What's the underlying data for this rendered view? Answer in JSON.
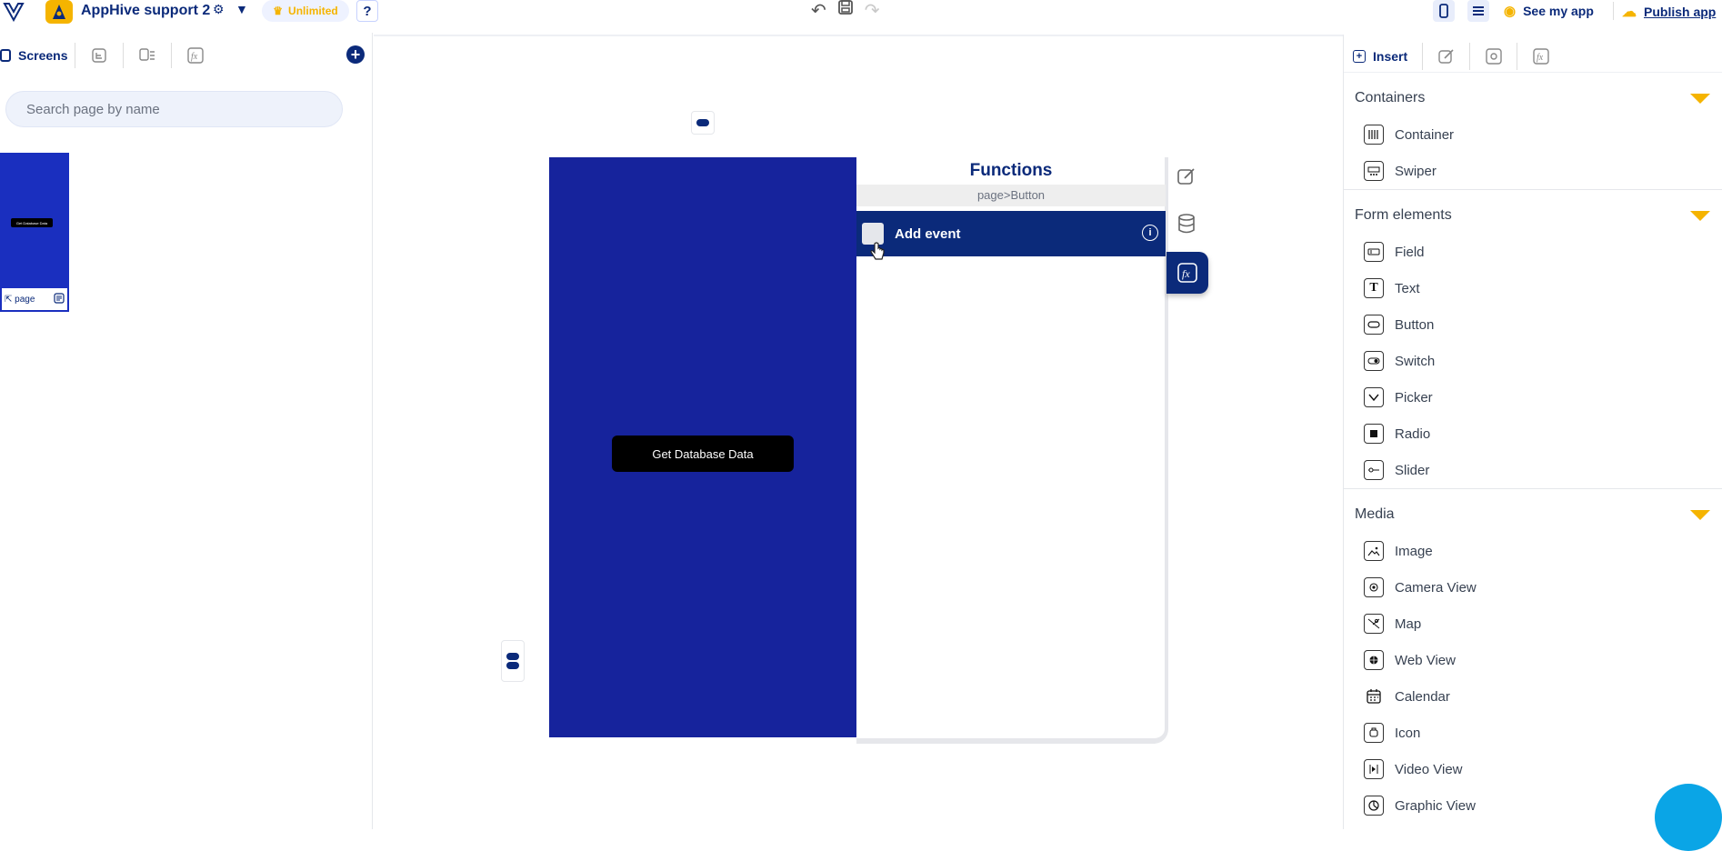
{
  "topbar": {
    "app_name": "AppHive support 2",
    "plan_badge": "Unlimited",
    "help": "?",
    "see_my_app": "See my app",
    "publish_app": "Publish app"
  },
  "left_panel": {
    "tab_screens": "Screens",
    "search_placeholder": "Search page by name",
    "thumbnail": {
      "button_label": "Get Database Data",
      "page_label": "page"
    }
  },
  "canvas": {
    "button_label": "Get Database Data"
  },
  "functions_panel": {
    "title": "Functions",
    "breadcrumb": "page>Button",
    "add_event": "Add event",
    "info": "i"
  },
  "right_panel": {
    "tab_insert": "Insert",
    "sections": [
      {
        "title": "Containers",
        "items": [
          "Container",
          "Swiper"
        ]
      },
      {
        "title": "Form elements",
        "items": [
          "Field",
          "Text",
          "Button",
          "Switch",
          "Picker",
          "Radio",
          "Slider"
        ]
      },
      {
        "title": "Media",
        "items": [
          "Image",
          "Camera View",
          "Map",
          "Web View",
          "Calendar",
          "Icon",
          "Video View",
          "Graphic View"
        ]
      }
    ]
  },
  "colors": {
    "brand_navy": "#0b2a7a",
    "accent_yellow": "#f5b400",
    "phone_bg": "#16239c",
    "chat_blue": "#0aa5e6"
  }
}
